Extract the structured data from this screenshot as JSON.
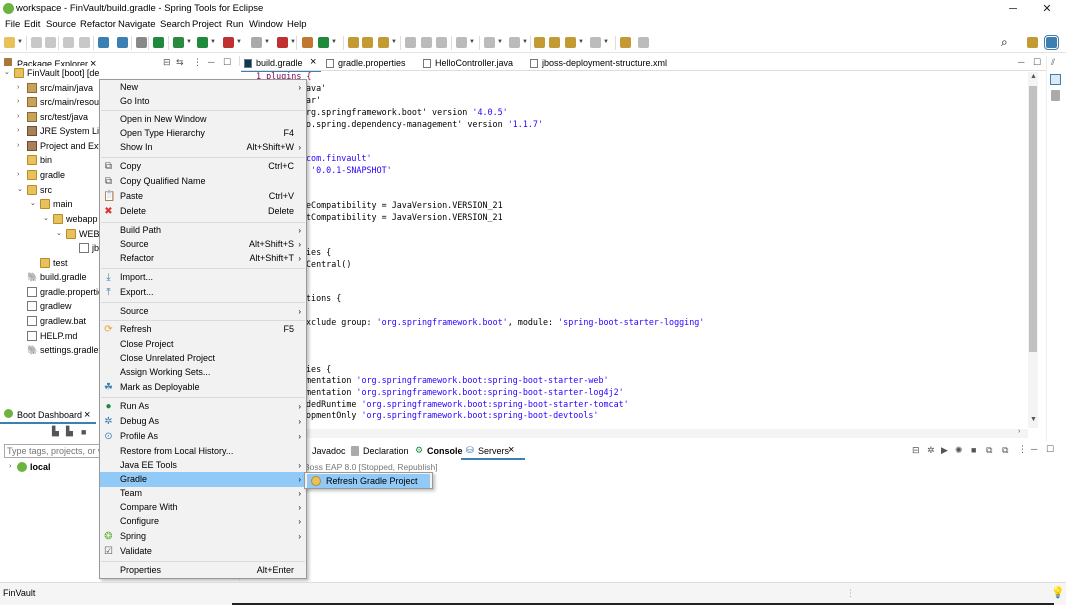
{
  "window": {
    "title": "workspace - FinVault/build.gradle - Spring Tools for Eclipse",
    "min": "─",
    "max": "☐",
    "close": "✕"
  },
  "menubar": [
    "File",
    "Edit",
    "Source",
    "Refactor",
    "Navigate",
    "Search",
    "Project",
    "Run",
    "Window",
    "Help"
  ],
  "package_explorer": {
    "tab_label": "Package Explorer",
    "tree": [
      {
        "label": "FinVault [boot] [de",
        "icon": "project"
      },
      {
        "label": "src/main/java",
        "icon": "package-folder"
      },
      {
        "label": "src/main/resourc",
        "icon": "package-folder"
      },
      {
        "label": "src/test/java",
        "icon": "package-folder"
      },
      {
        "label": "JRE System Libra",
        "icon": "library"
      },
      {
        "label": "Project and Exte",
        "icon": "library"
      },
      {
        "label": "bin",
        "icon": "folder"
      },
      {
        "label": "gradle",
        "icon": "folder"
      },
      {
        "label": "src",
        "icon": "folder"
      },
      {
        "label": "main",
        "icon": "folder"
      },
      {
        "label": "webapp",
        "icon": "folder"
      },
      {
        "label": "WEB-IN",
        "icon": "folder"
      },
      {
        "label": "jbos",
        "icon": "file"
      },
      {
        "label": "test",
        "icon": "folder"
      },
      {
        "label": "build.gradle",
        "icon": "gradle"
      },
      {
        "label": "gradle.propertie",
        "icon": "file"
      },
      {
        "label": "gradlew",
        "icon": "file"
      },
      {
        "label": "gradlew.bat",
        "icon": "file"
      },
      {
        "label": "HELP.md",
        "icon": "file"
      },
      {
        "label": "settings.gradle",
        "icon": "gradle"
      }
    ]
  },
  "editor_tabs": [
    "build.gradle",
    "gradle.properties",
    "HelloController.java",
    "jboss-deployment-structure.xml"
  ],
  "code": [
    {
      "pre": "1 plugins {",
      "str": "",
      "post": ""
    },
    {
      "pre": "ava'",
      "str": "",
      "post": ""
    },
    {
      "pre": "ar'",
      "str": "",
      "post": ""
    },
    {
      "pre": "rg.springframework.boot' version ",
      "str": "'4.0.5'",
      "post": ""
    },
    {
      "pre": "o.spring.dependency-management' version ",
      "str": "'1.1.7'",
      "post": ""
    },
    {
      "pre": "",
      "str": "com.finvault'",
      "post": ""
    },
    {
      "pre": " ",
      "str": "'0.0.1-SNAPSHOT'",
      "post": ""
    },
    {
      "pre": "eCompatibility = JavaVersion.VERSION_21",
      "str": "",
      "post": ""
    },
    {
      "pre": "tCompatibility = JavaVersion.VERSION_21",
      "str": "",
      "post": ""
    },
    {
      "pre": "ies {",
      "str": "",
      "post": ""
    },
    {
      "pre": "Central()",
      "str": "",
      "post": ""
    },
    {
      "pre": "tions {",
      "str": "",
      "post": ""
    },
    {
      "pre": "xclude group: ",
      "str": "'org.springframework.boot'",
      "post": ", module: 'spring-boot-starter-logging'"
    },
    {
      "pre": "ies {",
      "str": "",
      "post": ""
    },
    {
      "pre": "mentation ",
      "str": "'org.springframework.boot:spring-boot-starter-web'",
      "post": ""
    },
    {
      "pre": "mentation ",
      "str": "'org.springframework.boot:spring-boot-starter-log4j2'",
      "post": ""
    },
    {
      "pre": "dedRuntime ",
      "str": "'org.springframework.boot:spring-boot-starter-tomcat'",
      "post": ""
    },
    {
      "pre": "opmentOnly ",
      "str": "'org.springframework.boot:spring-boot-devtools'",
      "post": ""
    }
  ],
  "boot_dashboard": {
    "tab_label": "Boot Dashboard",
    "filter_placeholder": "Type tags, projects, or wo",
    "local_label": "local"
  },
  "bottom_tabs": {
    "javadoc": "Javadoc",
    "declaration": "Declaration",
    "console": "Console",
    "servers": "Servers",
    "server_row": "Boss EAP 8.0  [Stopped, Republish]"
  },
  "context_menu": [
    {
      "label": "New",
      "shortcut": "",
      "arrow": true,
      "icon": ""
    },
    {
      "label": "Go Into",
      "shortcut": "",
      "arrow": false,
      "icon": ""
    },
    {
      "sep": true
    },
    {
      "label": "Open in New Window",
      "shortcut": "",
      "arrow": false,
      "icon": ""
    },
    {
      "label": "Open Type Hierarchy",
      "shortcut": "F4",
      "arrow": false,
      "icon": ""
    },
    {
      "label": "Show In",
      "shortcut": "Alt+Shift+W",
      "arrow": true,
      "icon": ""
    },
    {
      "sep": true
    },
    {
      "label": "Copy",
      "shortcut": "Ctrl+C",
      "arrow": false,
      "icon": "copy"
    },
    {
      "label": "Copy Qualified Name",
      "shortcut": "",
      "arrow": false,
      "icon": "copy"
    },
    {
      "label": "Paste",
      "shortcut": "Ctrl+V",
      "arrow": false,
      "icon": "paste"
    },
    {
      "label": "Delete",
      "shortcut": "Delete",
      "arrow": false,
      "icon": "delete"
    },
    {
      "sep": true
    },
    {
      "label": "Build Path",
      "shortcut": "",
      "arrow": true,
      "icon": ""
    },
    {
      "label": "Source",
      "shortcut": "Alt+Shift+S",
      "arrow": true,
      "icon": ""
    },
    {
      "label": "Refactor",
      "shortcut": "Alt+Shift+T",
      "arrow": true,
      "icon": ""
    },
    {
      "sep": true
    },
    {
      "label": "Import...",
      "shortcut": "",
      "arrow": false,
      "icon": "import"
    },
    {
      "label": "Export...",
      "shortcut": "",
      "arrow": false,
      "icon": "export"
    },
    {
      "sep": true
    },
    {
      "label": "Source",
      "shortcut": "",
      "arrow": true,
      "icon": ""
    },
    {
      "sep": true
    },
    {
      "label": "Refresh",
      "shortcut": "F5",
      "arrow": false,
      "icon": "refresh"
    },
    {
      "label": "Close Project",
      "shortcut": "",
      "arrow": false,
      "icon": ""
    },
    {
      "label": "Close Unrelated Project",
      "shortcut": "",
      "arrow": false,
      "icon": ""
    },
    {
      "label": "Assign Working Sets...",
      "shortcut": "",
      "arrow": false,
      "icon": ""
    },
    {
      "label": "Mark as Deployable",
      "shortcut": "",
      "arrow": false,
      "icon": "deploy"
    },
    {
      "sep": true
    },
    {
      "label": "Run As",
      "shortcut": "",
      "arrow": true,
      "icon": "run"
    },
    {
      "label": "Debug As",
      "shortcut": "",
      "arrow": true,
      "icon": "debug"
    },
    {
      "label": "Profile As",
      "shortcut": "",
      "arrow": true,
      "icon": "profile"
    },
    {
      "label": "Restore from Local History...",
      "shortcut": "",
      "arrow": false,
      "icon": ""
    },
    {
      "label": "Java EE Tools",
      "shortcut": "",
      "arrow": true,
      "icon": ""
    },
    {
      "label": "Gradle",
      "shortcut": "",
      "arrow": true,
      "icon": "",
      "highlight": true
    },
    {
      "label": "Team",
      "shortcut": "",
      "arrow": true,
      "icon": ""
    },
    {
      "label": "Compare With",
      "shortcut": "",
      "arrow": true,
      "icon": ""
    },
    {
      "label": "Configure",
      "shortcut": "",
      "arrow": true,
      "icon": ""
    },
    {
      "label": "Spring",
      "shortcut": "",
      "arrow": true,
      "icon": "spring"
    },
    {
      "label": "Validate",
      "shortcut": "",
      "arrow": false,
      "icon": "validate"
    },
    {
      "sep": true
    },
    {
      "label": "Properties",
      "shortcut": "Alt+Enter",
      "arrow": false,
      "icon": ""
    }
  ],
  "submenu": {
    "label": "Refresh Gradle Project"
  },
  "status": {
    "text": "FinVault"
  }
}
